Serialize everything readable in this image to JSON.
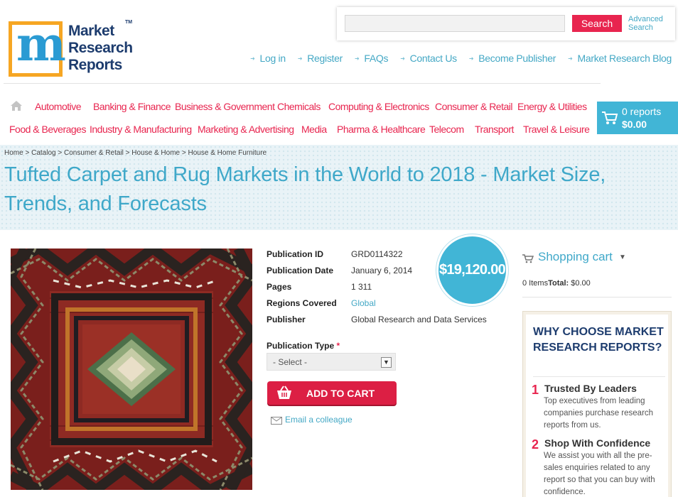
{
  "logo": {
    "line1": "Market",
    "line2": "Research",
    "line3": "Reports",
    "tm": "TM",
    "letter": "m"
  },
  "search": {
    "placeholder": "",
    "value": "",
    "button": "Search",
    "advanced_line1": "Advanced",
    "advanced_line2": "Search"
  },
  "top_links": [
    "Log in",
    "Register",
    "FAQs",
    "Contact Us",
    "Become Publisher",
    "Market Research Blog"
  ],
  "categories_row1": [
    "Automotive",
    "Banking & Finance",
    "Business & Government",
    "Chemicals",
    "Computing & Electronics",
    "Consumer & Retail",
    "Energy & Utilities"
  ],
  "categories_row2": [
    "Food & Beverages",
    "Industry & Manufacturing",
    "Marketing & Advertising",
    "Media",
    "Pharma & Healthcare",
    "Telecom",
    "Transport",
    "Travel & Leisure"
  ],
  "cart": {
    "reports": "0 reports",
    "total": "$0.00"
  },
  "breadcrumb": [
    "Home",
    "Catalog",
    "Consumer & Retail",
    "House & Home",
    "House & Home Furniture"
  ],
  "breadcrumb_sep": ">",
  "title": "Tufted Carpet and Rug Markets in the World to 2018 - Market Size, Trends, and Forecasts",
  "details": [
    {
      "label": "Publication ID",
      "value": "GRD0114322"
    },
    {
      "label": "Publication Date",
      "value": "January 6, 2014"
    },
    {
      "label": "Pages",
      "value": "1 311"
    },
    {
      "label": "Regions Covered",
      "value": "Global"
    },
    {
      "label": "Publisher",
      "value": "Global Research and Data Services"
    }
  ],
  "price": "$19,120.00",
  "publication_type": {
    "label": "Publication Type",
    "required_mark": "*",
    "selected": "- Select -"
  },
  "add_to_cart": "ADD TO CART",
  "email_colleague": "Email a colleague",
  "sidebar": {
    "shopping_cart": "Shopping cart",
    "items_label": "0 Items",
    "total_label": "Total:",
    "total_value": "$0.00",
    "why_title": "WHY CHOOSE MARKET RESEARCH REPORTS?",
    "reasons": [
      {
        "num": "1",
        "head": "Trusted By Leaders",
        "body": "Top executives from leading companies purchase research reports from us."
      },
      {
        "num": "2",
        "head": "Shop With Confidence",
        "body": "We assist you with all the pre-sales enquiries related to any report so that you can buy with confidence."
      }
    ]
  },
  "colors": {
    "accent_blue": "#41b5d6",
    "accent_red": "#e8254f",
    "logo_orange": "#f6a623",
    "logo_navy": "#1d3c6e"
  },
  "icons": [
    "home-icon",
    "cart-icon",
    "basket-icon",
    "envelope-icon",
    "chevron-down-icon"
  ]
}
